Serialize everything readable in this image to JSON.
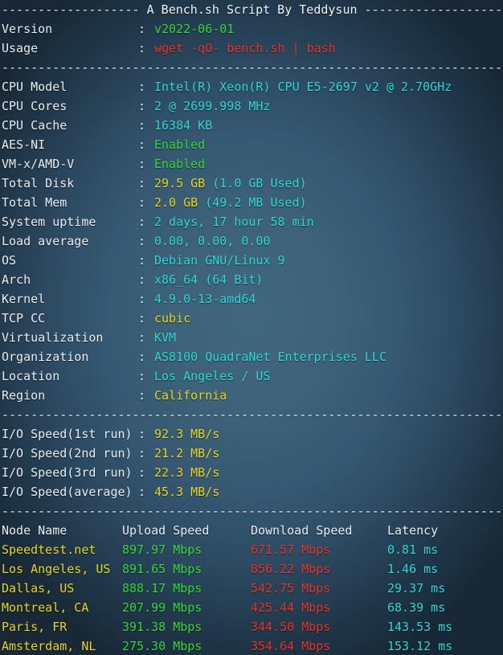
{
  "header": {
    "title_line": "------------------- A Bench.sh Script By Teddysun -------------------",
    "separator": "----------------------------------------------------------------------"
  },
  "meta": {
    "rows": [
      {
        "label": "Version",
        "colon": ":",
        "value": "v2022-06-01",
        "color": "green"
      },
      {
        "label": "Usage",
        "colon": ":",
        "value": "wget -qO- bench.sh | bash",
        "color": "red"
      }
    ]
  },
  "system": {
    "rows": [
      {
        "label": "CPU Model",
        "colon": ":",
        "value": "Intel(R) Xeon(R) CPU E5-2697 v2 @ 2.70GHz",
        "color": "cyan"
      },
      {
        "label": "CPU Cores",
        "colon": ":",
        "value": "2 @ 2699.998 MHz",
        "color": "cyan"
      },
      {
        "label": "CPU Cache",
        "colon": ":",
        "value": "16384 KB",
        "color": "cyan"
      },
      {
        "label": "AES-NI",
        "colon": ":",
        "value": "Enabled",
        "color": "green"
      },
      {
        "label": "VM-x/AMD-V",
        "colon": ":",
        "value": "Enabled",
        "color": "green"
      },
      {
        "label": "Total Disk",
        "colon": ":",
        "value": "29.5 GB",
        "suffix": " (1.0 GB Used)",
        "color": "yellow",
        "suffix_color": "cyan"
      },
      {
        "label": "Total Mem",
        "colon": ":",
        "value": "2.0 GB",
        "suffix": " (49.2 MB Used)",
        "color": "yellow",
        "suffix_color": "cyan"
      },
      {
        "label": "System uptime",
        "colon": ":",
        "value": "2 days, 17 hour 58 min",
        "color": "cyan"
      },
      {
        "label": "Load average",
        "colon": ":",
        "value": "0.00, 0.00, 0.00",
        "color": "cyan"
      },
      {
        "label": "OS",
        "colon": ":",
        "value": "Debian GNU/Linux 9",
        "color": "cyan"
      },
      {
        "label": "Arch",
        "colon": ":",
        "value": "x86_64 (64 Bit)",
        "color": "cyan"
      },
      {
        "label": "Kernel",
        "colon": ":",
        "value": "4.9.0-13-amd64",
        "color": "cyan"
      },
      {
        "label": "TCP CC",
        "colon": ":",
        "value": "cubic",
        "color": "yellow"
      },
      {
        "label": "Virtualization",
        "colon": ":",
        "value": "KVM",
        "color": "cyan"
      },
      {
        "label": "Organization",
        "colon": ":",
        "value": "AS8100 QuadraNet Enterprises LLC",
        "color": "cyan"
      },
      {
        "label": "Location",
        "colon": ":",
        "value": "Los Angeles / US",
        "color": "cyan"
      },
      {
        "label": "Region",
        "colon": ":",
        "value": "California",
        "color": "yellow"
      }
    ]
  },
  "io": {
    "rows": [
      {
        "label": "I/O Speed(1st run)",
        "colon": ":",
        "value": "92.3 MB/s",
        "color": "yellow"
      },
      {
        "label": "I/O Speed(2nd run)",
        "colon": ":",
        "value": "21.2 MB/s",
        "color": "yellow"
      },
      {
        "label": "I/O Speed(3rd run)",
        "colon": ":",
        "value": "22.3 MB/s",
        "color": "yellow"
      },
      {
        "label": "I/O Speed(average)",
        "colon": ":",
        "value": "45.3 MB/s",
        "color": "yellow"
      }
    ]
  },
  "speedtest": {
    "headers": {
      "node": "Node Name",
      "upload": "Upload Speed",
      "download": "Download Speed",
      "latency": "Latency"
    },
    "rows": [
      {
        "node": "Speedtest.net",
        "upload": "897.97 Mbps",
        "download": "671.57 Mbps",
        "latency": "0.81 ms"
      },
      {
        "node": "Los Angeles, US",
        "upload": "891.65 Mbps",
        "download": "856.22 Mbps",
        "latency": "1.46 ms"
      },
      {
        "node": "Dallas, US",
        "upload": "888.17 Mbps",
        "download": "542.75 Mbps",
        "latency": "29.37 ms"
      },
      {
        "node": "Montreal, CA",
        "upload": "207.99 Mbps",
        "download": "425.44 Mbps",
        "latency": "68.39 ms"
      },
      {
        "node": "Paris, FR",
        "upload": "391.38 Mbps",
        "download": "344.50 Mbps",
        "latency": "143.53 ms"
      },
      {
        "node": "Amsterdam, NL",
        "upload": "275.30 Mbps",
        "download": "354.64 Mbps",
        "latency": "153.12 ms"
      }
    ]
  },
  "colors": {
    "background": "#3d6179",
    "white": "#e8eef2",
    "cyan": "#2fd8d8",
    "green": "#35d73a",
    "red": "#e5352b",
    "yellow": "#e7d61f"
  }
}
